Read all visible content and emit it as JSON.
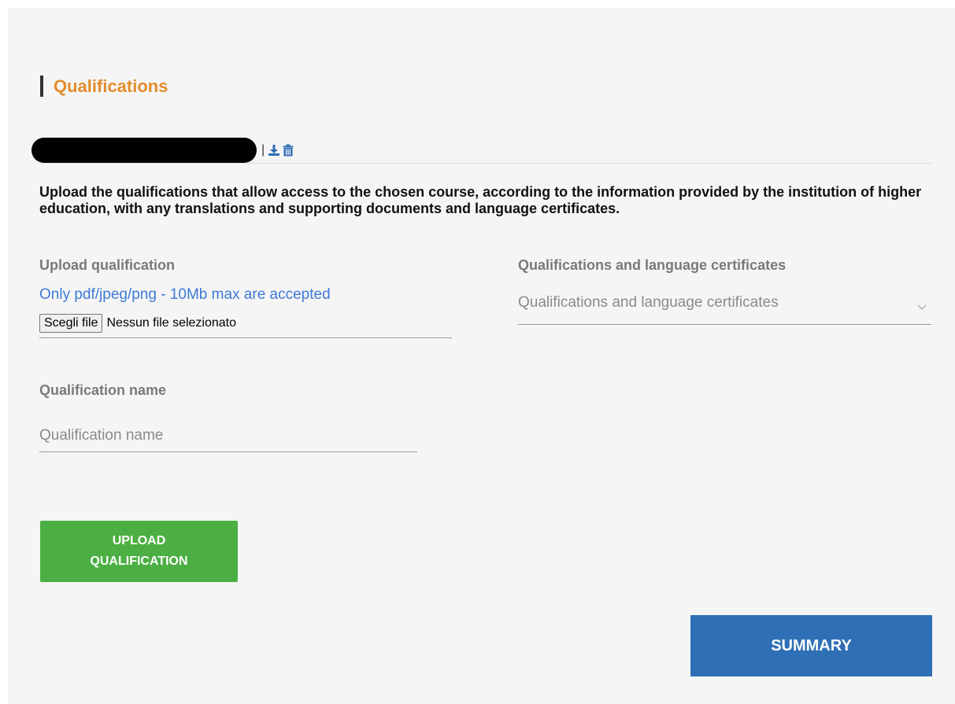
{
  "section": {
    "title": "Qualifications"
  },
  "file_row": {
    "separator": "|",
    "icons": [
      "download-icon",
      "trash-icon"
    ]
  },
  "instructions": "Upload the qualifications that allow access to the chosen course, according to the information provided by the institution of higher education, with any translations and supporting documents and language certificates.",
  "upload": {
    "label": "Upload qualification",
    "hint": "Only pdf/jpeg/png - 10Mb max are accepted",
    "choose_button": "Scegli file",
    "status": "Nessun file selezionato"
  },
  "certificates": {
    "label": "Qualifications and language certificates",
    "value": "Qualifications and language certificates"
  },
  "qualification_name": {
    "label": "Qualification name",
    "placeholder": "Qualification name"
  },
  "buttons": {
    "upload": "UPLOAD QUALIFICATION",
    "summary": "SUMMARY"
  },
  "colors": {
    "title": "#e38c2c",
    "hint": "#3d7ad6",
    "upload_button": "#4caf43",
    "summary_button": "#2f6fb5",
    "icons": "#2f6fb5"
  }
}
